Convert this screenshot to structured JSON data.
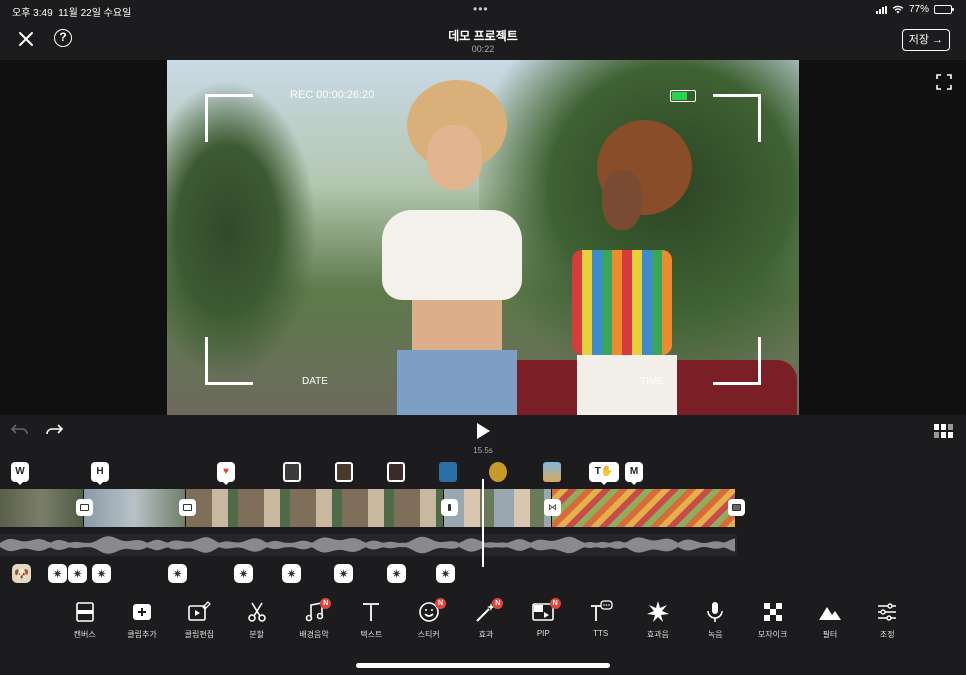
{
  "status": {
    "time": "오후 3:49",
    "date": "11월 22일 수요일",
    "battery": "77%",
    "battery_level": 0.77
  },
  "header": {
    "title": "데모 프로젝트",
    "duration": "00:22",
    "save_label": "저장",
    "save_arrow": "→"
  },
  "preview": {
    "rec_text": "REC 00:00:26:20",
    "date_label": "DATE",
    "time_label": "TIME"
  },
  "playback": {
    "time": "15.5s"
  },
  "timeline": {
    "top_markers": [
      {
        "label": "W"
      },
      {
        "label": "H"
      },
      {
        "label": "T"
      },
      {
        "label": "M"
      }
    ]
  },
  "tools": [
    {
      "label": "캔버스",
      "icon": "canvas-icon"
    },
    {
      "label": "클립추가",
      "icon": "add-clip-icon"
    },
    {
      "label": "클립편집",
      "icon": "edit-clip-icon"
    },
    {
      "label": "분할",
      "icon": "scissors-icon"
    },
    {
      "label": "배경음악",
      "icon": "music-icon",
      "badge": "N"
    },
    {
      "label": "텍스트",
      "icon": "text-icon"
    },
    {
      "label": "스티커",
      "icon": "sticker-icon",
      "badge": "N"
    },
    {
      "label": "효과",
      "icon": "magic-wand-icon",
      "badge": "N"
    },
    {
      "label": "PIP",
      "icon": "pip-icon",
      "badge": "N"
    },
    {
      "label": "TTS",
      "icon": "tts-icon"
    },
    {
      "label": "효과음",
      "icon": "sound-effect-icon"
    },
    {
      "label": "녹음",
      "icon": "microphone-icon"
    },
    {
      "label": "모자이크",
      "icon": "mosaic-icon"
    },
    {
      "label": "필터",
      "icon": "filter-icon"
    },
    {
      "label": "조정",
      "icon": "sliders-icon"
    }
  ],
  "colors": {
    "background": "#1c1c1e",
    "badge": "#e0463e",
    "battery_green": "#2bd34d"
  }
}
